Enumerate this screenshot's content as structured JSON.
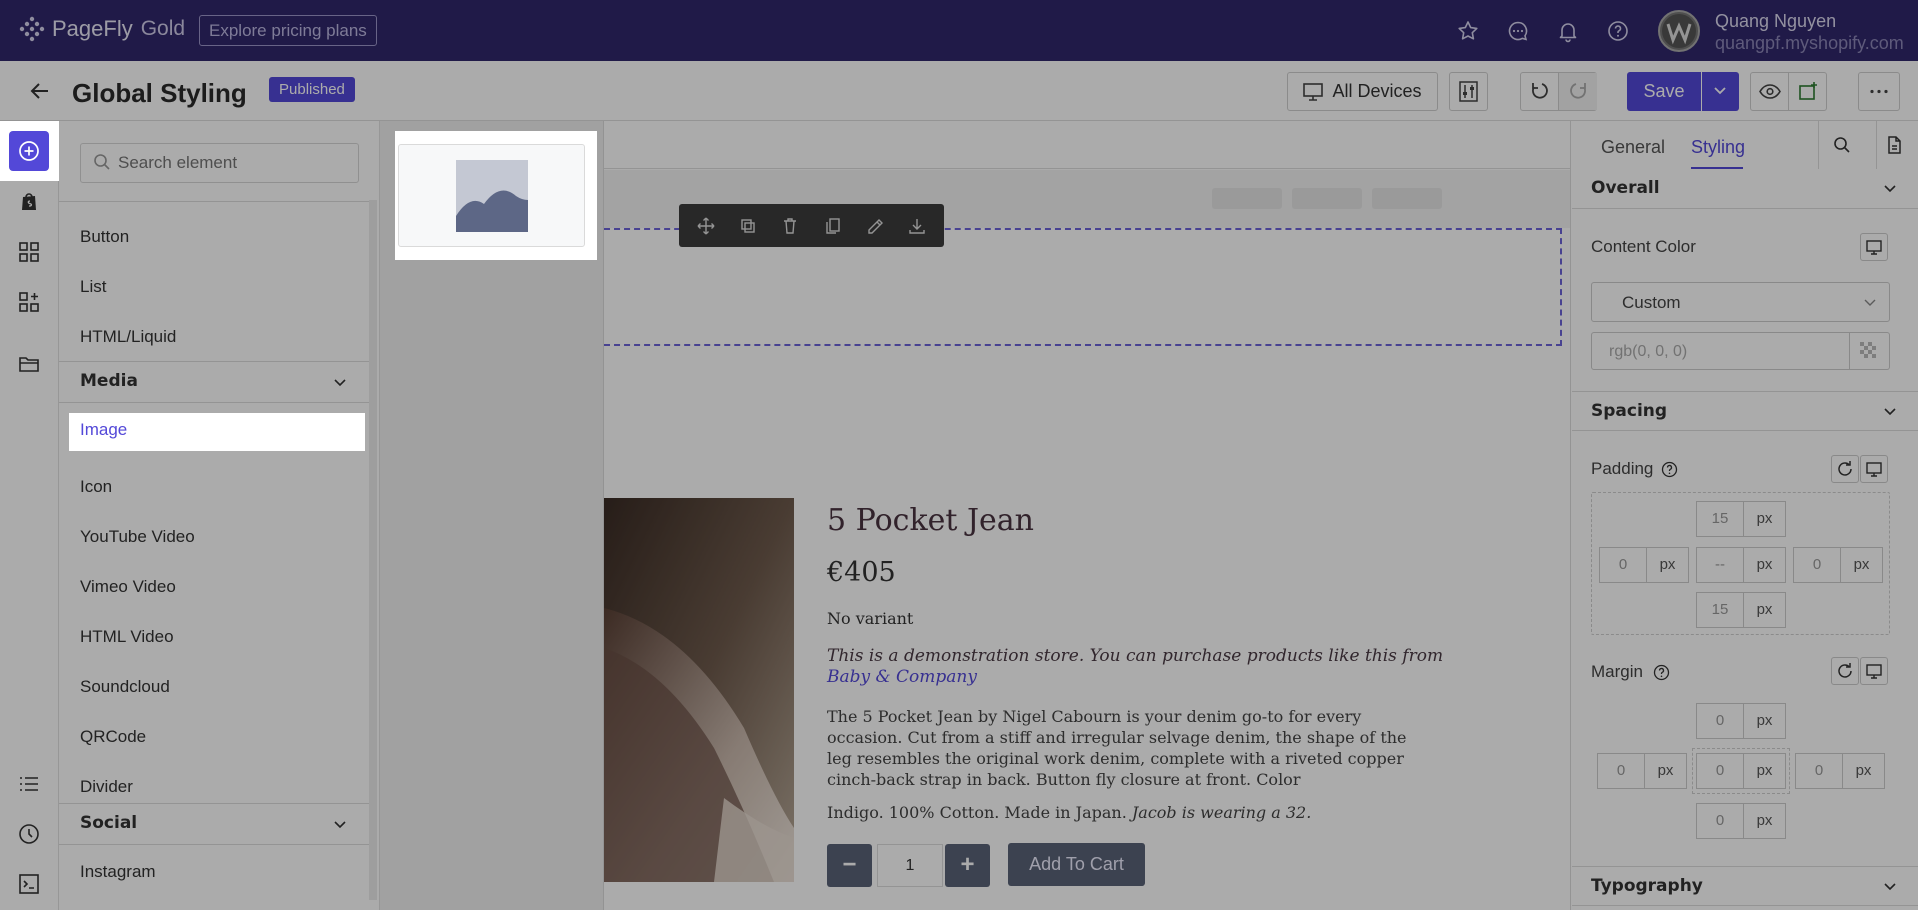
{
  "topbar": {
    "brand": "PageFly",
    "tier": "Gold",
    "pricing_link": "Explore pricing plans",
    "user_name": "Quang Nguyen",
    "user_shop": "quangpf.myshopify.com",
    "icons": [
      "star-icon",
      "chat-icon",
      "bell-icon",
      "help-icon"
    ]
  },
  "titlebar": {
    "title": "Global Styling",
    "status": "Published",
    "device": "All Devices",
    "save": "Save"
  },
  "sidebar": {
    "search_placeholder": "Search element",
    "items_top": [
      "Button",
      "List",
      "HTML/Liquid"
    ],
    "media_header": "Media",
    "media_selected": "Image",
    "media_items": [
      "Icon",
      "YouTube Video",
      "Vimeo Video",
      "HTML Video",
      "Soundcloud",
      "QRCode",
      "Divider"
    ],
    "social_header": "Social",
    "social_items": [
      "Instagram"
    ]
  },
  "product": {
    "title": "5 Pocket Jean",
    "price": "€405",
    "variant": "No variant",
    "demo_text": "This is a demonstration store. You can purchase products like this from ",
    "demo_link": "Baby & Company",
    "description": "The 5 Pocket Jean by Nigel Cabourn is your denim go-to for every occasion. Cut from a stiff and irregular selvage denim, the shape of the leg resembles the original work denim, complete with a riveted copper cinch-back strap in back. Button fly closure at front. Color",
    "description2": "Indigo. 100% Cotton. Made in Japan. ",
    "description2_italic": "Jacob is wearing a 32.",
    "qty": "1",
    "minus": "−",
    "plus": "+",
    "add_to_cart": "Add To Cart"
  },
  "right_panel": {
    "tab_general": "General",
    "tab_styling": "Styling",
    "overall": "Overall",
    "content_color": "Content Color",
    "color_mode": "Custom",
    "color_value": "rgb(0, 0, 0)",
    "spacing": "Spacing",
    "padding_label": "Padding",
    "padding": {
      "top": "15",
      "left": "0",
      "center": "--",
      "right": "0",
      "bottom": "15"
    },
    "margin_label": "Margin",
    "margin": {
      "top": "0",
      "left": "0",
      "center": "0",
      "right": "0",
      "bottom": "0"
    },
    "unit": "px",
    "typography": "Typography"
  },
  "colors": {
    "brand": "#5348d8",
    "topbar": "#30286c",
    "button": "#5a6378"
  }
}
